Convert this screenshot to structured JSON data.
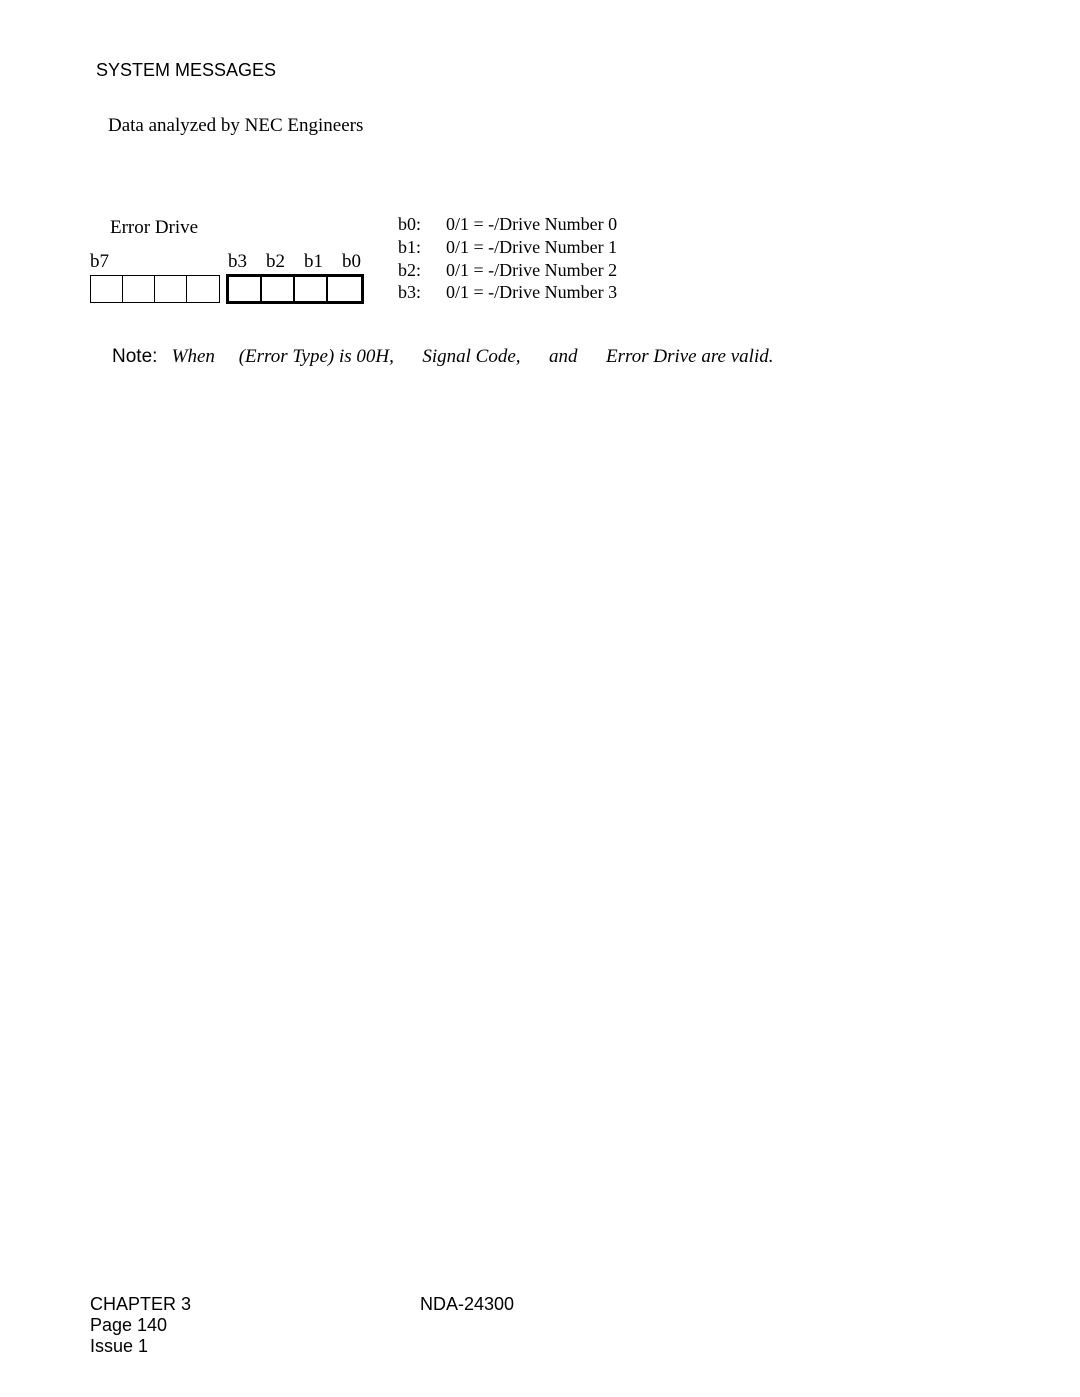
{
  "header": {
    "title": "SYSTEM MESSAGES",
    "subtitle": "Data analyzed by NEC Engineers"
  },
  "diagram": {
    "error_drive_label": "Error Drive",
    "b7_label": "b7",
    "bit_labels": "b3    b2    b1    b0",
    "defs": [
      {
        "key": "b0:",
        "val": "0/1 = -/Drive Number 0"
      },
      {
        "key": "b1:",
        "val": "0/1 = -/Drive Number 1"
      },
      {
        "key": "b2:",
        "val": "0/1 = -/Drive Number 2"
      },
      {
        "key": "b3:",
        "val": "0/1 = -/Drive Number 3"
      }
    ]
  },
  "note": {
    "label": "Note:",
    "segments": {
      "a": "When ",
      "b": "(Error Type) is 00H,",
      "c": "Signal Code,",
      "d": "and",
      "e": "Error Drive are valid."
    }
  },
  "footer": {
    "chapter": "CHAPTER 3",
    "page": "Page 140",
    "issue": "Issue 1",
    "doc": "NDA-24300"
  }
}
